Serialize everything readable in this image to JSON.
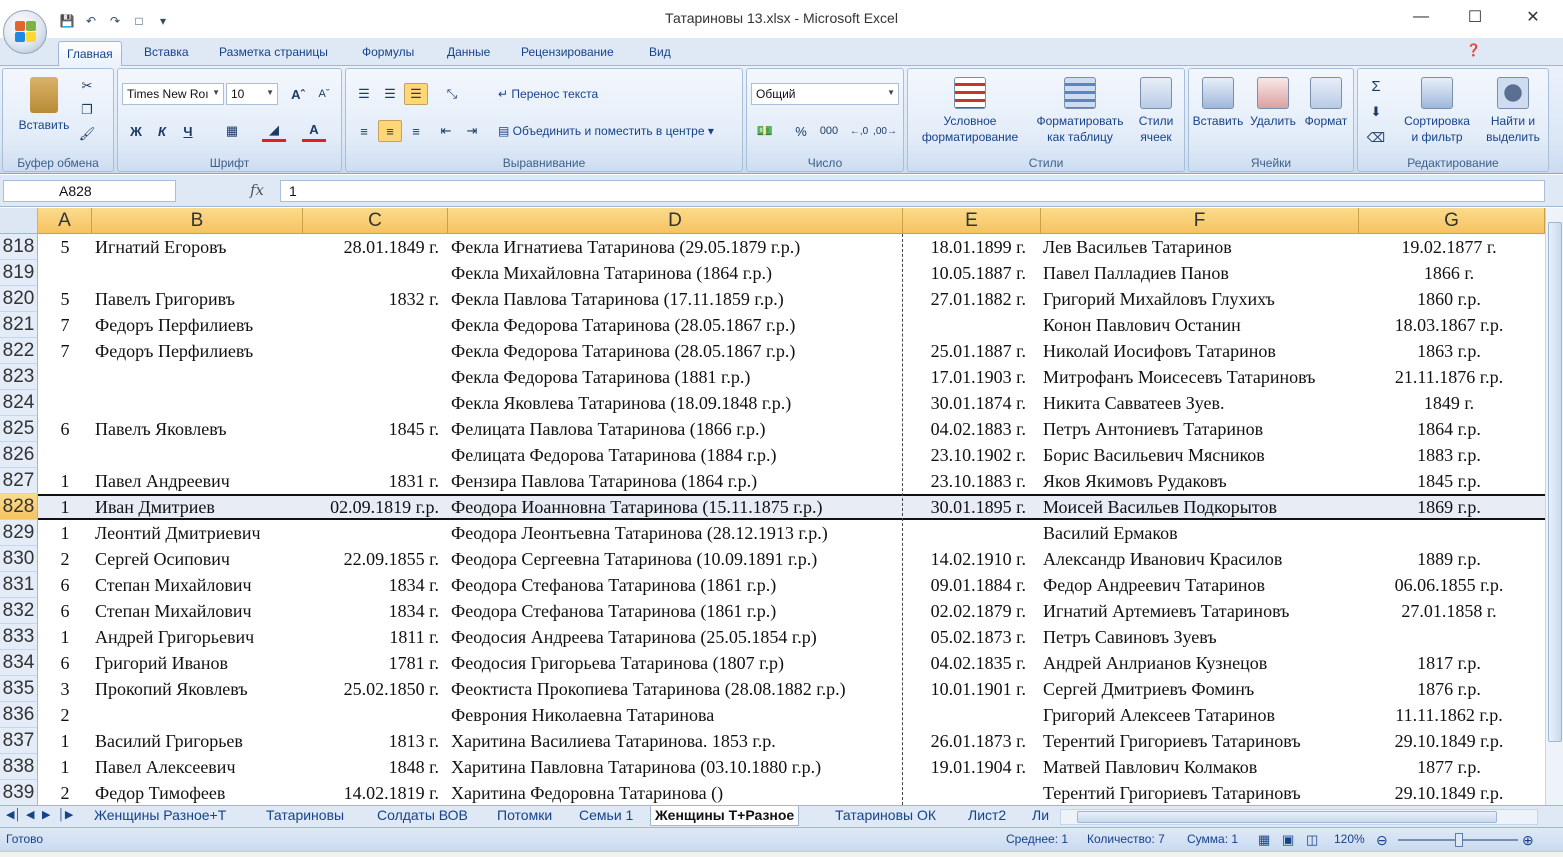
{
  "window": {
    "title": "Татариновы 13.xlsx - Microsoft Excel",
    "minimize": "—",
    "maximize": "☐",
    "close": "✕"
  },
  "ribbon_tabs": [
    "Главная",
    "Вставка",
    "Разметка страницы",
    "Формулы",
    "Данные",
    "Рецензирование",
    "Вид"
  ],
  "ribbon": {
    "clipboard": {
      "paste": "Вставить",
      "label": "Буфер обмена"
    },
    "font": {
      "name": "Times New Roı",
      "size": "10",
      "bold": "Ж",
      "italic": "К",
      "underline": "Ч",
      "label": "Шрифт"
    },
    "alignment": {
      "wrap": "Перенос текста",
      "merge": "Объединить и поместить в центре",
      "label": "Выравнивание"
    },
    "number": {
      "format": "Общий",
      "percent": "%",
      "thousands": "000",
      "label": "Число"
    },
    "styles": {
      "conditional_1": "Условное",
      "conditional_2": "форматирование",
      "table_1": "Форматировать",
      "table_2": "как таблицу",
      "cell_1": "Стили",
      "cell_2": "ячеек",
      "label": "Стили"
    },
    "cells": {
      "insert": "Вставить",
      "delete": "Удалить",
      "format": "Формат",
      "label": "Ячейки"
    },
    "editing": {
      "sort_1": "Сортировка",
      "sort_2": "и фильтр",
      "find_1": "Найти и",
      "find_2": "выделить",
      "sigma": "Σ",
      "label": "Редактирование"
    }
  },
  "formula_bar": {
    "name_box": "A828",
    "fx": "fx",
    "value": "1"
  },
  "columns": [
    "A",
    "B",
    "C",
    "D",
    "E",
    "F",
    "G"
  ],
  "rows": [
    {
      "n": "818",
      "a": "5",
      "b": "Игнатий Егоровъ",
      "c": "28.01.1849 г.",
      "d": "Фекла Игнатиева Татаринова (29.05.1879 г.р.)",
      "e": "18.01.1899 г.",
      "f": "Лев Васильев Татаринов",
      "g": "19.02.1877 г."
    },
    {
      "n": "819",
      "a": "",
      "b": "",
      "c": "",
      "d": "Фекла Михайловна Татаринова  (1864 г.р.)",
      "e": "10.05.1887 г.",
      "f": "Павел Палладиев Панов",
      "g": "1866 г."
    },
    {
      "n": "820",
      "a": "5",
      "b": "Павелъ Григоривъ",
      "c": "1832 г.",
      "d": "Фекла Павлова Татаринова  (17.11.1859 г.р.)",
      "e": "27.01.1882 г.",
      "f": "Григорий Михайловъ Глухихъ",
      "g": "1860 г.р."
    },
    {
      "n": "821",
      "a": "7",
      "b": "Федоръ Перфилиевъ",
      "c": "",
      "d": "Фекла Федорова Татаринова (28.05.1867 г.р.)",
      "e": "",
      "f": "Конон Павлович Останин",
      "g": "18.03.1867 г.р."
    },
    {
      "n": "822",
      "a": "7",
      "b": "Федоръ Перфилиевъ",
      "c": "",
      "d": "Фекла Федорова Татаринова (28.05.1867 г.р.)",
      "e": "25.01.1887 г.",
      "f": "Николай Иосифовъ Татаринов",
      "g": "1863 г.р."
    },
    {
      "n": "823",
      "a": "",
      "b": "",
      "c": "",
      "d": "Фекла Федорова Татаринова (1881 г.р.)",
      "e": "17.01.1903 г.",
      "f": "Митрофанъ Моисесевъ Татариновъ",
      "g": "21.11.1876 г.р."
    },
    {
      "n": "824",
      "a": "",
      "b": "",
      "c": "",
      "d": "Фекла Яковлева Татаринова (18.09.1848 г.р.)",
      "e": "30.01.1874 г.",
      "f": "Никита Савватеев Зуев.",
      "g": "1849 г."
    },
    {
      "n": "825",
      "a": "6",
      "b": "Павелъ Яковлевъ",
      "c": "1845 г.",
      "d": "Фелицата Павлова Татаринова (1866 г.р.)",
      "e": "04.02.1883 г.",
      "f": "Петръ Антониевъ Татаринов",
      "g": "1864 г.р."
    },
    {
      "n": "826",
      "a": "",
      "b": "",
      "c": "",
      "d": "Фелицата Федорова Татаринова (1884 г.р.)",
      "e": "23.10.1902 г.",
      "f": "Борис Васильевич Мясников",
      "g": "1883 г.р."
    },
    {
      "n": "827",
      "a": "1",
      "b": "Павел Андреевич",
      "c": "1831 г.",
      "d": "Фензира Павлова Татаринова (1864 г.р.)",
      "e": "23.10.1883 г.",
      "f": "Яков Якимовъ Рудаковъ",
      "g": "1845 г.р."
    },
    {
      "n": "828",
      "a": "1",
      "b": "Иван Дмитриев",
      "c": "02.09.1819 г.р.",
      "d": "Феодора Иоанновна Татаринова (15.11.1875 г.р.)",
      "e": "30.01.1895 г.",
      "f": "Моисей Васильев Подкорытов",
      "g": "1869 г.р."
    },
    {
      "n": "829",
      "a": "1",
      "b": "Леонтий Дмитриевич",
      "c": "",
      "d": "Феодора Леонтьевна Татаринова (28.12.1913 г.р.)",
      "e": "",
      "f": "Василий Ермаков",
      "g": ""
    },
    {
      "n": "830",
      "a": "2",
      "b": "Сергей Осипович",
      "c": "22.09.1855 г.",
      "d": "Феодора Сергеевна Татаринова (10.09.1891 г.р.)",
      "e": "14.02.1910 г.",
      "f": "Александр Иванович Красилов",
      "g": "1889 г.р."
    },
    {
      "n": "831",
      "a": "6",
      "b": "Степан Михайлович",
      "c": "1834 г.",
      "d": "Феодора Стефанова Татаринова (1861 г.р.)",
      "e": "09.01.1884 г.",
      "f": "Федор Андреевич Татаринов",
      "g": "06.06.1855 г.р."
    },
    {
      "n": "832",
      "a": "6",
      "b": "Степан Михайлович",
      "c": "1834 г.",
      "d": "Феодора Стефанова Татаринова (1861 г.р.)",
      "e": "02.02.1879 г.",
      "f": "Игнатий Артемиевъ Татариновъ",
      "g": "27.01.1858 г."
    },
    {
      "n": "833",
      "a": "1",
      "b": "Андрей Григорьевич",
      "c": "1811 г.",
      "d": "Феодосия Андреева Татаринова (25.05.1854 г.р)",
      "e": "05.02.1873 г.",
      "f": "Петръ Савиновъ Зуевъ",
      "g": ""
    },
    {
      "n": "834",
      "a": "6",
      "b": "Григорий Иванов",
      "c": "1781 г.",
      "d": "Феодосия Григорьева Татаринова (1807 г.р)",
      "e": "04.02.1835 г.",
      "f": "Андрей Анлрианов Кузнецов",
      "g": "1817 г.р."
    },
    {
      "n": "835",
      "a": "3",
      "b": "Прокопий Яковлевъ",
      "c": "25.02.1850 г.",
      "d": "Феоктиста Прокопиева Татаринова (28.08.1882 г.р.)",
      "e": "10.01.1901 г.",
      "f": "Сергей Дмитриевъ Фоминъ",
      "g": "1876 г.р."
    },
    {
      "n": "836",
      "a": "2",
      "b": "",
      "c": "",
      "d": "Феврония Николаевна Татаринова",
      "e": "",
      "f": "Григорий Алексеев Татаринов",
      "g": "11.11.1862 г.р."
    },
    {
      "n": "837",
      "a": "1",
      "b": "Василий Григорьев",
      "c": "1813 г.",
      "d": "Харитина Василиева Татаринова. 1853 г.р.",
      "e": "26.01.1873 г.",
      "f": "Терентий Григориевъ Татариновъ",
      "g": "29.10.1849 г.р."
    },
    {
      "n": "838",
      "a": "1",
      "b": "Павел Алексеевич",
      "c": "1848 г.",
      "d": "Харитина Павловна Татаринова (03.10.1880 г.р.)",
      "e": "19.01.1904 г.",
      "f": "Матвей Павлович Колмаков",
      "g": "1877 г.р."
    },
    {
      "n": "839",
      "a": "2",
      "b": "Федор Тимофеев",
      "c": "14.02.1819 г.",
      "d": "Харитина Федоровна Татаринова ()",
      "e": "",
      "f": "Терентий Григориевъ Татариновъ",
      "g": "29.10.1849 г.р."
    }
  ],
  "selected_row": "828",
  "sheet_tabs": [
    "Женщины Разное+Т",
    "Татариновы",
    "Солдаты ВОВ",
    "Потомки",
    "Семьи 1",
    "Женщины Т+Разное",
    "Татариновы ОК",
    "Лист2",
    "Ли"
  ],
  "active_sheet": "Женщины Т+Разное",
  "status": {
    "ready": "Готово",
    "average": "Среднее: 1",
    "count": "Количество: 7",
    "sum": "Сумма: 1",
    "zoom": "120%"
  }
}
